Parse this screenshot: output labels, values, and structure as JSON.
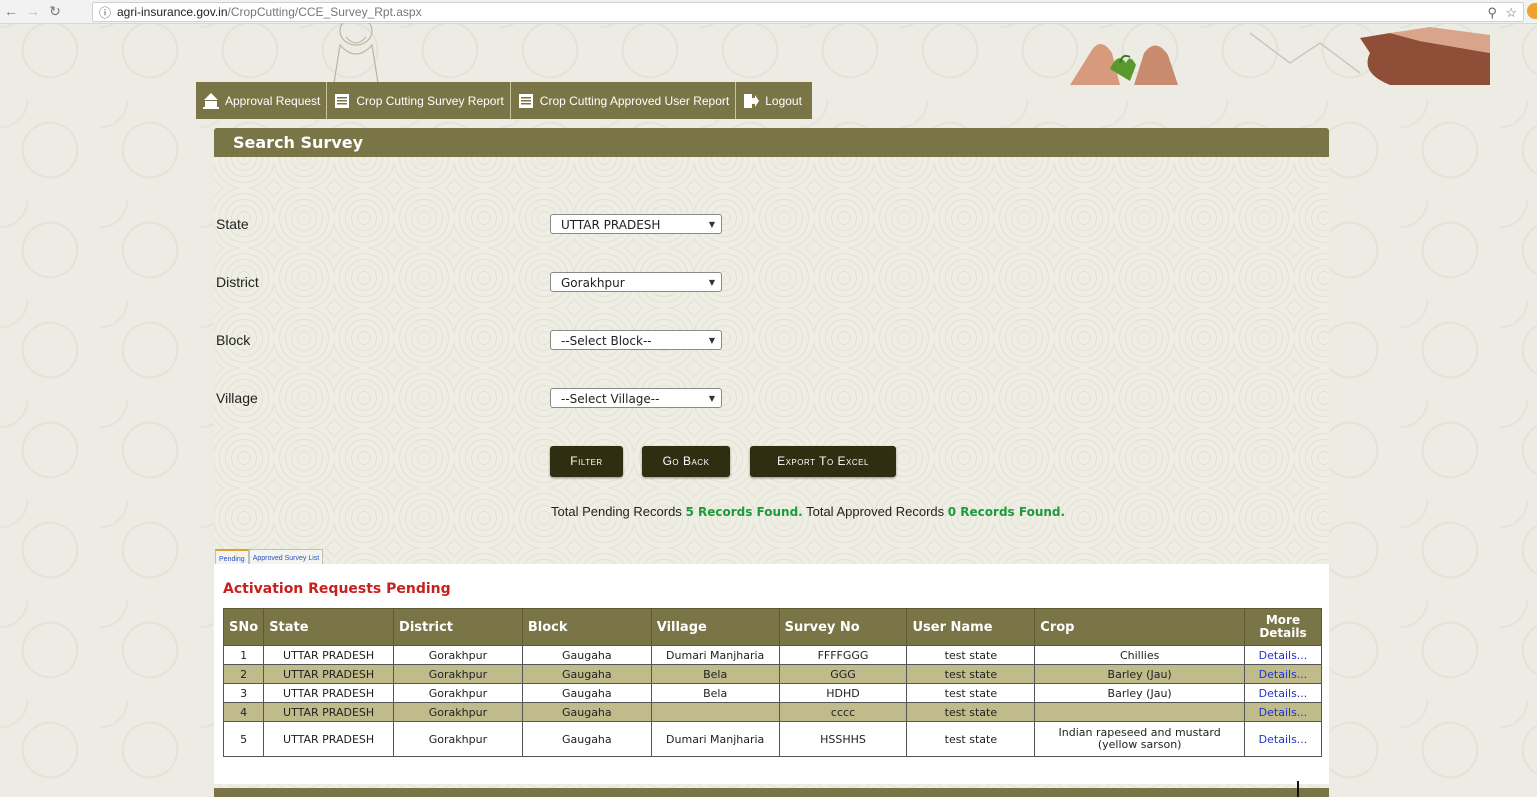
{
  "browser": {
    "url_host": "agri-insurance.gov.in",
    "url_path": "/CropCutting/CCE_Survey_Rpt.aspx"
  },
  "nav": {
    "items": [
      {
        "label": "Approval Request",
        "icon": "building-icon"
      },
      {
        "label": "Crop Cutting Survey Report",
        "icon": "report-icon"
      },
      {
        "label": "Crop Cutting Approved User Report",
        "icon": "report-icon"
      },
      {
        "label": "Logout",
        "icon": "logout-icon"
      }
    ]
  },
  "search": {
    "title": "Search Survey",
    "state_label": "State",
    "state_value": "UTTAR PRADESH",
    "district_label": "District",
    "district_value": "Gorakhpur",
    "block_label": "Block",
    "block_value": "--Select Block--",
    "village_label": "Village",
    "village_value": "--Select Village--",
    "filter_label": "Filter",
    "goback_label": "Go Back",
    "export_label": "Export To Excel"
  },
  "records": {
    "pending_prefix": "Total Pending Records",
    "pending_count": "5 Records Found.",
    "approved_prefix": "Total Approved Records",
    "approved_count": "0 Records Found."
  },
  "tabs": [
    "Pending",
    "Approved Survey List"
  ],
  "pending_title": "Activation Requests Pending",
  "table": {
    "headers": [
      "SNo",
      "State",
      "District",
      "Block",
      "Village",
      "Survey No",
      "User Name",
      "Crop",
      "More Details"
    ],
    "rows": [
      [
        "1",
        "UTTAR PRADESH",
        "Gorakhpur",
        "Gaugaha",
        "Dumari Manjharia",
        "FFFFGGG",
        "test state",
        "Chillies",
        "Details..."
      ],
      [
        "2",
        "UTTAR PRADESH",
        "Gorakhpur",
        "Gaugaha",
        "Bela",
        "GGG",
        "test state",
        "Barley (Jau)",
        "Details..."
      ],
      [
        "3",
        "UTTAR PRADESH",
        "Gorakhpur",
        "Gaugaha",
        "Bela",
        "HDHD",
        "test state",
        "Barley (Jau)",
        "Details..."
      ],
      [
        "4",
        "UTTAR PRADESH",
        "Gorakhpur",
        "Gaugaha",
        "",
        "cccc",
        "test state",
        "",
        "Details..."
      ],
      [
        "5",
        "UTTAR PRADESH",
        "Gorakhpur",
        "Gaugaha",
        "Dumari Manjharia",
        "HSSHHS",
        "test state",
        "Indian rapeseed and mustard (yellow sarson)",
        "Details..."
      ]
    ]
  },
  "colors": {
    "brand_olive": "#7a7546",
    "button_dark": "#2f2e10",
    "alt_row": "#bfbb8a",
    "highlight_green": "#1d9a3c",
    "title_red": "#c8201e"
  }
}
